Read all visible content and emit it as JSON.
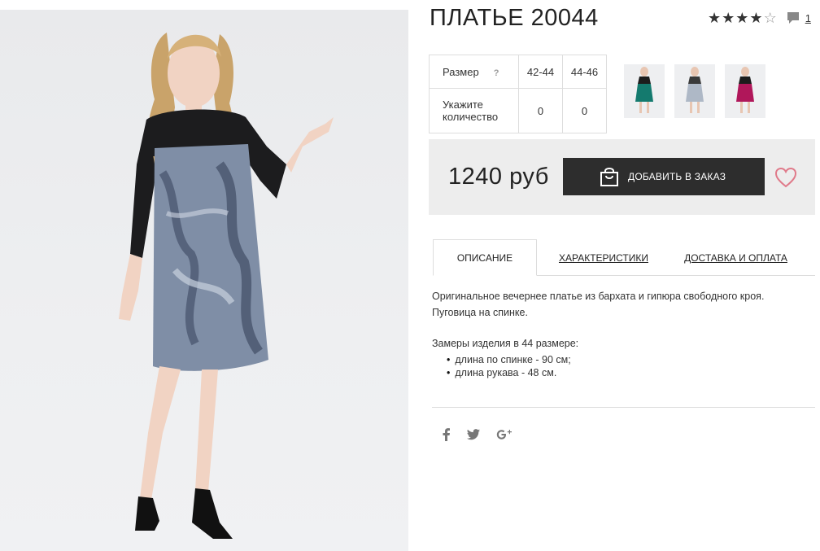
{
  "product": {
    "title": "ПЛАТЬЕ 20044",
    "rating_stars": 4,
    "rating_max": 5,
    "review_count": "1"
  },
  "sizes": {
    "size_label": "Размер",
    "help_mark": "?",
    "qty_label": "Укажите количество",
    "columns": [
      "42-44",
      "44-46"
    ],
    "quantities": [
      "0",
      "0"
    ]
  },
  "thumbnails": [
    {
      "icon": "thumb-green-dress"
    },
    {
      "icon": "thumb-grey-dress"
    },
    {
      "icon": "thumb-magenta-dress"
    }
  ],
  "purchase": {
    "price": "1240 руб",
    "add_label": "ДОБАВИТЬ В ЗАКАЗ"
  },
  "tabs": [
    {
      "label": "ОПИСАНИЕ",
      "active": true
    },
    {
      "label": "ХАРАКТЕРИСТИКИ",
      "active": false
    },
    {
      "label": "ДОСТАВКА И ОПЛАТА",
      "active": false
    }
  ],
  "description": {
    "line1": "Оригинальное вечернее платье из бархата и гипюра свободного кроя.",
    "line2": "Пуговица на спинке.",
    "measures_title": "Замеры изделия в 44 размере:",
    "measures": [
      "длина по спинке - 90 см;",
      "длина рукава - 48 см."
    ]
  },
  "social": [
    "facebook-icon",
    "twitter-icon",
    "google-plus-icon"
  ],
  "colors": {
    "button_bg": "#2d2d2d",
    "price_box_bg": "#ededed",
    "heart": "#e07a8a"
  }
}
